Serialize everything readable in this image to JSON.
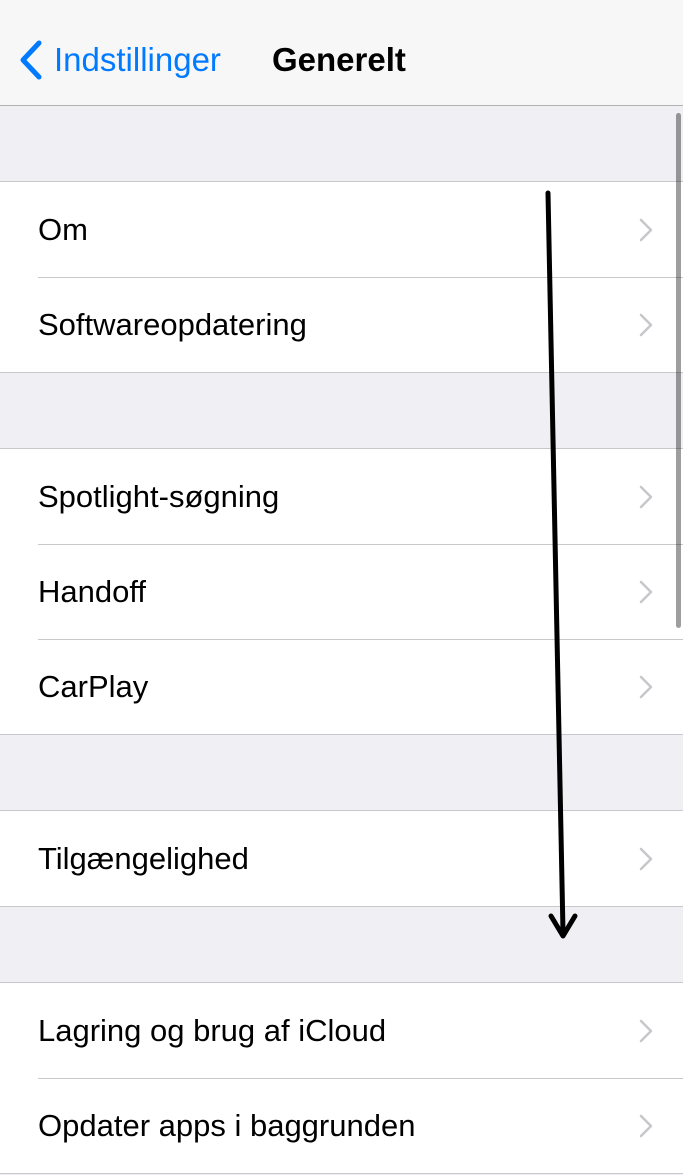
{
  "navbar": {
    "back_label": "Indstillinger",
    "title": "Generelt"
  },
  "groups": [
    {
      "items": [
        {
          "label": "Om"
        },
        {
          "label": "Softwareopdatering"
        }
      ]
    },
    {
      "items": [
        {
          "label": "Spotlight-søgning"
        },
        {
          "label": "Handoff"
        },
        {
          "label": "CarPlay"
        }
      ]
    },
    {
      "items": [
        {
          "label": "Tilgængelighed"
        }
      ]
    },
    {
      "items": [
        {
          "label": "Lagring og brug af iCloud"
        },
        {
          "label": "Opdater apps i baggrunden"
        }
      ]
    }
  ],
  "icons": {
    "back": "chevron-left-icon",
    "disclosure": "chevron-right-icon"
  },
  "colors": {
    "accent": "#007aff",
    "disclosure": "#c7c7cc",
    "background": "#efeff4",
    "annotation": "#000000"
  }
}
